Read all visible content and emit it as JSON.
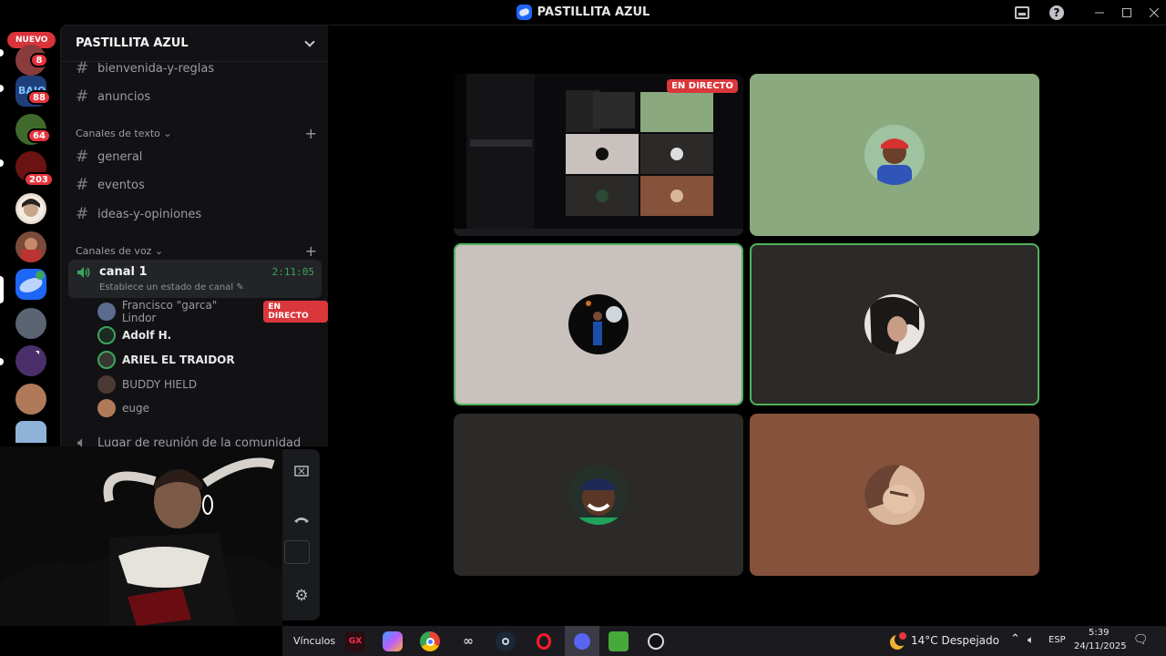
{
  "window": {
    "title": "PASTILLITA AZUL"
  },
  "rail": {
    "nuevo_label": "NUEVO",
    "badges": [
      "8",
      "88",
      "64",
      "203"
    ]
  },
  "sidebar": {
    "guild_name": "PASTILLITA AZUL",
    "top_channels": [
      "bienvenida-y-reglas",
      "anuncios"
    ],
    "text_category": "Canales de texto",
    "text_channels": [
      "general",
      "eventos",
      "ideas-y-opiniones"
    ],
    "voice_category": "Canales de voz",
    "voice_channel": {
      "name": "canal 1",
      "elapsed": "2:11:05",
      "status_prompt": "Establece un estado de canal"
    },
    "members": [
      {
        "name": "Francisco \"garca\" Lindor",
        "live": "EN DIRECTO"
      },
      {
        "name": "Adolf H."
      },
      {
        "name": "ARIEL EL TRAIDOR"
      },
      {
        "name": "BUDDY HIELD"
      },
      {
        "name": "euge"
      }
    ],
    "next_channel": "Lugar de reunión de la comunidad"
  },
  "stage": {
    "live_tag": "EN DIRECTO"
  },
  "taskbar": {
    "links_label": "Vínculos",
    "weather_alert": "1",
    "weather": "14°C  Despejado",
    "lang": "ESP",
    "time": "5:39",
    "date": "24/11/2025",
    "gx_label": "GX"
  },
  "colors": {
    "accent_green": "#4fb35b",
    "live_red": "#da373c",
    "tile_green": "#8aa97f",
    "tile_grey": "#c9c1bd",
    "tile_dark": "#2c2a28",
    "tile_brown": "#86523b"
  }
}
